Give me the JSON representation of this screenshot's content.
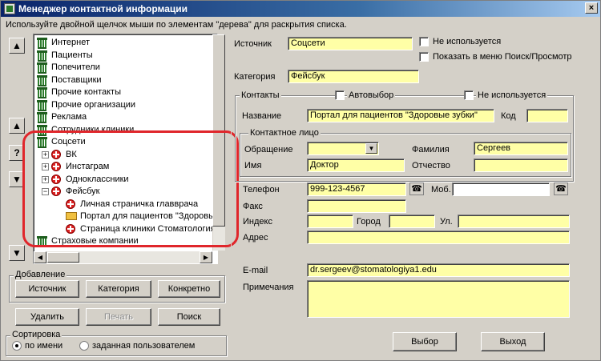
{
  "window": {
    "title": "Менеджер контактной информации",
    "close_symbol": "×",
    "hint": "Используйте двойной щелчок мыши по элементам \"дерева\" для раскрытия списка."
  },
  "sidebar": {
    "top_symbol": "▲",
    "up_symbol": "▲",
    "help_symbol": "?",
    "down_symbol": "▼",
    "bottom_symbol": "▼"
  },
  "tree": {
    "items": [
      {
        "label": "Интернет",
        "icon": "bank-icon",
        "level": 0
      },
      {
        "label": "Пациенты",
        "icon": "bank-icon",
        "level": 0
      },
      {
        "label": "Попечители",
        "icon": "bank-icon",
        "level": 0
      },
      {
        "label": "Поставщики",
        "icon": "bank-icon",
        "level": 0
      },
      {
        "label": "Прочие контакты",
        "icon": "bank-icon",
        "level": 0
      },
      {
        "label": "Прочие организации",
        "icon": "bank-icon",
        "level": 0
      },
      {
        "label": "Реклама",
        "icon": "bank-icon",
        "level": 0
      },
      {
        "label": "Сотрудники клиники",
        "icon": "bank-icon",
        "level": 0
      },
      {
        "label": "Соцсети",
        "icon": "bank-icon",
        "level": 0
      },
      {
        "label": "ВК",
        "icon": "red-cross-icon",
        "level": 1,
        "expander": "+"
      },
      {
        "label": "Инстаграм",
        "icon": "red-cross-icon",
        "level": 1,
        "expander": "+"
      },
      {
        "label": "Одноклассники",
        "icon": "red-cross-icon",
        "level": 1,
        "expander": "+"
      },
      {
        "label": "Фейсбук",
        "icon": "red-cross-icon",
        "level": 1,
        "expander": "−"
      },
      {
        "label": "Личная страничка главврача",
        "icon": "red-cross-icon",
        "level": 2
      },
      {
        "label": "Портал для пациентов \"Здоровые зубки\"",
        "icon": "folder-icon",
        "level": 2
      },
      {
        "label": "Страница клиники Стоматология",
        "icon": "red-cross-icon",
        "level": 2
      },
      {
        "label": "Страховые компании",
        "icon": "bank-icon",
        "level": 0
      }
    ]
  },
  "add_group": {
    "title": "Добавление",
    "source_button": "Источник",
    "category_button": "Категория",
    "specific_button": "Конкретно"
  },
  "actions": {
    "delete_button": "Удалить",
    "print_button": "Печать",
    "search_button": "Поиск"
  },
  "sort_group": {
    "title": "Сортировка",
    "by_name": "по имени",
    "by_user": "заданная пользователем",
    "selected": "by_name"
  },
  "form": {
    "source_label": "Источник",
    "source_value": "Соцсети",
    "not_used_label": "Не используется",
    "show_in_menu_label": "Показать в меню Поиск/Просмотр",
    "category_label": "Категория",
    "category_value": "Фейсбук",
    "contacts_title": "Контакты",
    "autoselect_label": "Автовыбор",
    "contacts_not_used_label": "Не используется",
    "name_label": "Название",
    "name_value": "Портал для пациентов \"Здоровые зубки\"",
    "code_label": "Код",
    "code_value": "",
    "person_title": "Контактное лицо",
    "salutation_label": "Обращение",
    "salutation_value": "",
    "surname_label": "Фамилия",
    "surname_value": "Сергеев",
    "firstname_label": "Имя",
    "firstname_value": "Доктор",
    "patronymic_label": "Отчество",
    "patronymic_value": "",
    "phone_label": "Телефон",
    "phone_value": "999-123-4567",
    "mobile_label": "Моб.",
    "mobile_value": "",
    "fax_label": "Факс",
    "fax_value": "",
    "zip_label": "Индекс",
    "zip_value": "",
    "city_label": "Город",
    "city_value": "",
    "street_label": "Ул.",
    "street_value": "",
    "address_label": "Адрес",
    "address_value": "",
    "email_label": "E-mail",
    "email_value": "dr.sergeev@stomatologiya1.edu",
    "notes_label": "Примечания",
    "notes_value": ""
  },
  "footer": {
    "select_button": "Выбор",
    "exit_button": "Выход"
  },
  "colors": {
    "field_yellow": "#ffffa6",
    "highlight_red": "#e0262b",
    "titlebar_blue": "#0a246a"
  }
}
